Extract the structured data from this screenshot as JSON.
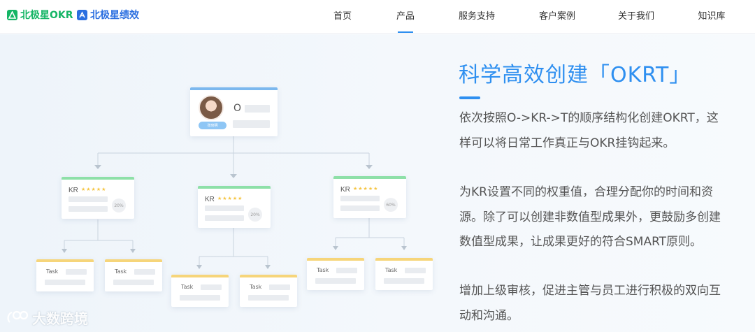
{
  "header": {
    "brand_primary": "北极星OKR",
    "brand_secondary": "北极星绩效",
    "nav": [
      {
        "label": "首页",
        "active": false
      },
      {
        "label": "产品",
        "active": true
      },
      {
        "label": "服务支持",
        "active": false
      },
      {
        "label": "客户案例",
        "active": false
      },
      {
        "label": "关于我们",
        "active": false
      },
      {
        "label": "知识库",
        "active": false
      }
    ]
  },
  "diagram": {
    "objective": {
      "label": "O",
      "tag": "张晓明"
    },
    "key_results": [
      {
        "label": "KR",
        "stars": "★★★★★",
        "percent": "20%"
      },
      {
        "label": "KR",
        "stars": "★★★★★",
        "percent": "20%"
      },
      {
        "label": "KR",
        "stars": "★★★★★",
        "percent": "60%"
      }
    ],
    "task_label": "Task"
  },
  "content": {
    "headline": "科学高效创建「OKRT」",
    "paragraphs": [
      "依次按照O->KR->T的顺序结构化创建OKRT，这样可以将日常工作真正与OKR挂钩起来。",
      "为KR设置不同的权重值，合理分配你的时间和资源。除了可以创建非数值型成果外，更鼓励多创建数值型成果，让成果更好的符合SMART原则。",
      "增加上级审核，促进主管与员工进行积极的双向互动和沟通。"
    ]
  },
  "watermark": {
    "text": "大数跨境"
  },
  "colors": {
    "accent": "#2e8ff0",
    "brand_green": "#14b565",
    "brand_blue": "#2b6fe0"
  }
}
